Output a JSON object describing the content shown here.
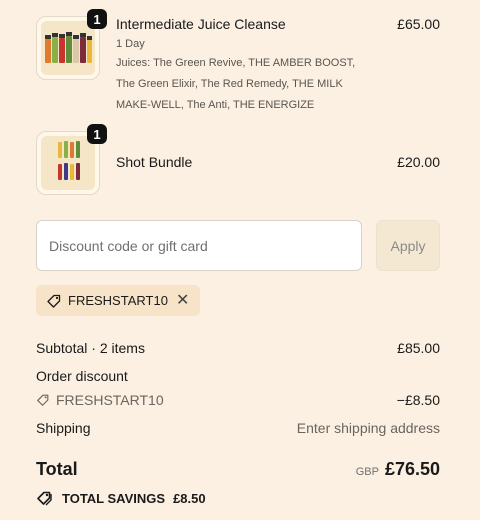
{
  "line_items": [
    {
      "quantity": "1",
      "name": "Intermediate Juice Cleanse",
      "variant": "1 Day",
      "description": "Juices: The Green Revive, THE AMBER BOOST, The Green Elixir, The Red Remedy, THE MILK MAKE-WELL, The Anti, THE ENERGIZE",
      "price": "£65.00"
    },
    {
      "quantity": "1",
      "name": "Shot Bundle",
      "price": "£20.00"
    }
  ],
  "discount": {
    "placeholder": "Discount code or gift card",
    "apply_label": "Apply",
    "applied_code": "FRESHSTART10"
  },
  "summary": {
    "subtotal_label": "Subtotal · 2 items",
    "subtotal_value": "£85.00",
    "order_discount_label": "Order discount",
    "discount_code": "FRESHSTART10",
    "discount_value": "−£8.50",
    "shipping_label": "Shipping",
    "shipping_value": "Enter shipping address",
    "total_label": "Total",
    "currency": "GBP",
    "total_value": "£76.50",
    "savings_label": "TOTAL SAVINGS",
    "savings_value": "£8.50"
  },
  "colors": {
    "background": "#fbf0e1",
    "badge": "#111111",
    "tag_background": "#f6e3c8"
  }
}
